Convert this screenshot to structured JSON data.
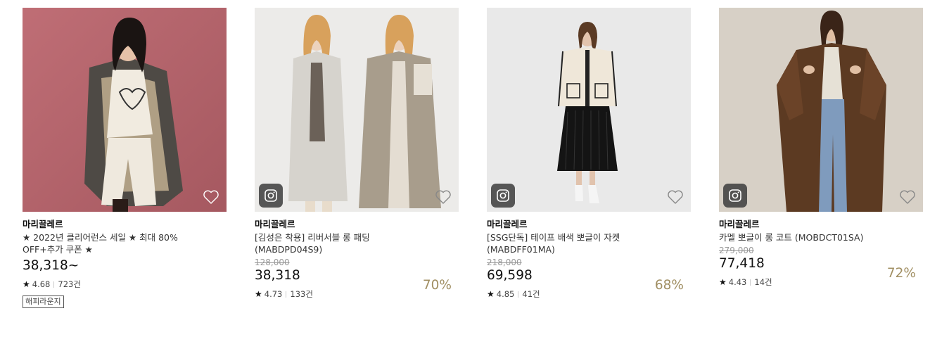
{
  "products": [
    {
      "brand": "마리끌레르",
      "name": "★ 2022년 클리어런스 세일 ★ 최대 80% OFF+추가 쿠폰 ★",
      "price": "38,318~",
      "rating": "4.68",
      "review_count": "723건",
      "badge": "해피라운지",
      "has_instagram": false,
      "bg_color": "#b5656f"
    },
    {
      "brand": "마리끌레르",
      "name": "[김성은 착용] 리버서블 롱 패딩 (MABDPD04S9)",
      "original_price": "128,000",
      "price": "38,318",
      "discount": "70%",
      "rating": "4.73",
      "review_count": "133건",
      "has_instagram": true,
      "bg_color": "#ecebe9"
    },
    {
      "brand": "마리끌레르",
      "name": "[SSG단독] 테이프 배색 뽀글이 자켓 (MABDFF01MA)",
      "original_price": "218,000",
      "price": "69,598",
      "discount": "68%",
      "rating": "4.85",
      "review_count": "41건",
      "has_instagram": true,
      "bg_color": "#e9e9e9"
    },
    {
      "brand": "마리끌레르",
      "name": "카멜 뽀글이 롱 코트 (MOBDCT01SA)",
      "original_price": "279,000",
      "price": "77,418",
      "discount": "72%",
      "rating": "4.43",
      "review_count": "14건",
      "has_instagram": true,
      "bg_color": "#d7d0c6"
    }
  ],
  "icons": {
    "wishlist": "heart-outline-icon",
    "instagram": "instagram-icon",
    "rating": "star-icon"
  },
  "colors": {
    "discount": "#a18f63",
    "original_price": "#999999"
  }
}
